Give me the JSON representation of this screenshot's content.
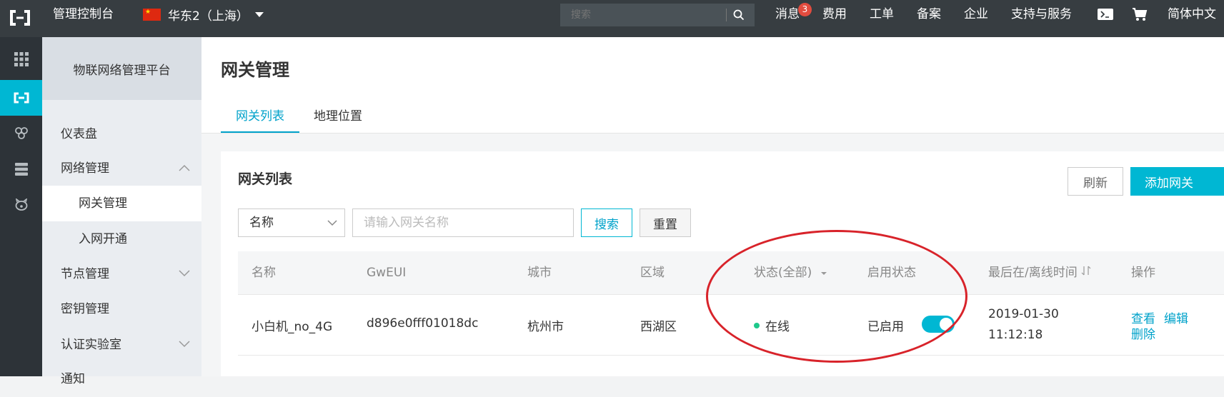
{
  "topbar": {
    "console_title": "管理控制台",
    "region": "华东2（上海）",
    "search_placeholder": "搜索",
    "nav": {
      "messages": "消息",
      "messages_count": "3",
      "fees": "费用",
      "tickets": "工单",
      "filing": "备案",
      "enterprise": "企业",
      "support": "支持与服务",
      "language": "简体中文"
    }
  },
  "sidebar": {
    "platform_title": "物联网络管理平台",
    "items": [
      {
        "label": "仪表盘"
      },
      {
        "label": "网络管理"
      },
      {
        "label": "网关管理"
      },
      {
        "label": "入网开通"
      },
      {
        "label": "节点管理"
      },
      {
        "label": "密钥管理"
      },
      {
        "label": "认证实验室"
      },
      {
        "label": "通知"
      }
    ]
  },
  "main": {
    "page_title": "网关管理",
    "tabs": [
      {
        "label": "网关列表"
      },
      {
        "label": "地理位置"
      }
    ],
    "card": {
      "title": "网关列表",
      "refresh_label": "刷新",
      "add_label": "添加网关",
      "filter": {
        "select_value": "名称",
        "input_placeholder": "请输入网关名称",
        "search_label": "搜索",
        "reset_label": "重置"
      },
      "columns": {
        "name": "名称",
        "gweui": "GwEUI",
        "city": "城市",
        "area": "区域",
        "status": "状态(全部)",
        "enabled": "启用状态",
        "last_time": "最后在/离线时间",
        "ops": "操作"
      },
      "rows": [
        {
          "name": "小白机_no_4G",
          "gweui": "d896e0fff01018dc",
          "city": "杭州市",
          "area": "西湖区",
          "status": "在线",
          "enabled_label": "已启用",
          "enabled": true,
          "last_date": "2019-01-30",
          "last_time": "11:12:18",
          "op_view": "查看",
          "op_edit": "编辑",
          "op_delete": "删除"
        }
      ]
    }
  },
  "colors": {
    "topbar": "#373d41",
    "accent": "#00b7d3",
    "link": "#00a2ca",
    "online_dot": "#1ec88b",
    "annotation": "#d8232a"
  }
}
